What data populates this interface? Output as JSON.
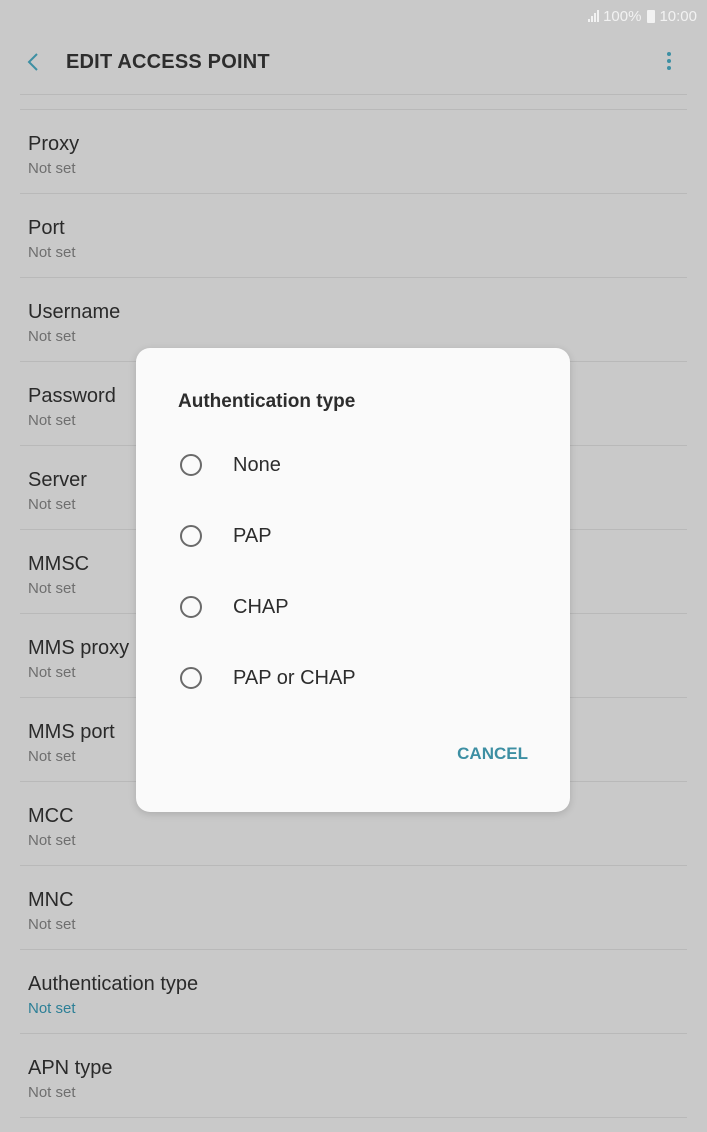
{
  "status_bar": {
    "battery": "100%",
    "time": "10:00"
  },
  "header": {
    "title": "EDIT ACCESS POINT",
    "back_icon": "back-chevron-icon",
    "menu_icon": "more-vert-icon"
  },
  "settings": [
    {
      "title": "Proxy",
      "value": "Not set"
    },
    {
      "title": "Port",
      "value": "Not set"
    },
    {
      "title": "Username",
      "value": "Not set"
    },
    {
      "title": "Password",
      "value": "Not set"
    },
    {
      "title": "Server",
      "value": "Not set"
    },
    {
      "title": "MMSC",
      "value": "Not set"
    },
    {
      "title": "MMS proxy",
      "value": "Not set"
    },
    {
      "title": "MMS port",
      "value": "Not set"
    },
    {
      "title": "MCC",
      "value": "Not set"
    },
    {
      "title": "MNC",
      "value": "Not set"
    },
    {
      "title": "Authentication type",
      "value": "Not set"
    },
    {
      "title": "APN type",
      "value": "Not set"
    }
  ],
  "dialog": {
    "title": "Authentication type",
    "options": [
      "None",
      "PAP",
      "CHAP",
      "PAP or CHAP"
    ],
    "cancel_label": "CANCEL"
  },
  "colors": {
    "accent": "#3d8fa3",
    "scrim_background": "#c9c9c9",
    "dialog_background": "#fafafa"
  }
}
